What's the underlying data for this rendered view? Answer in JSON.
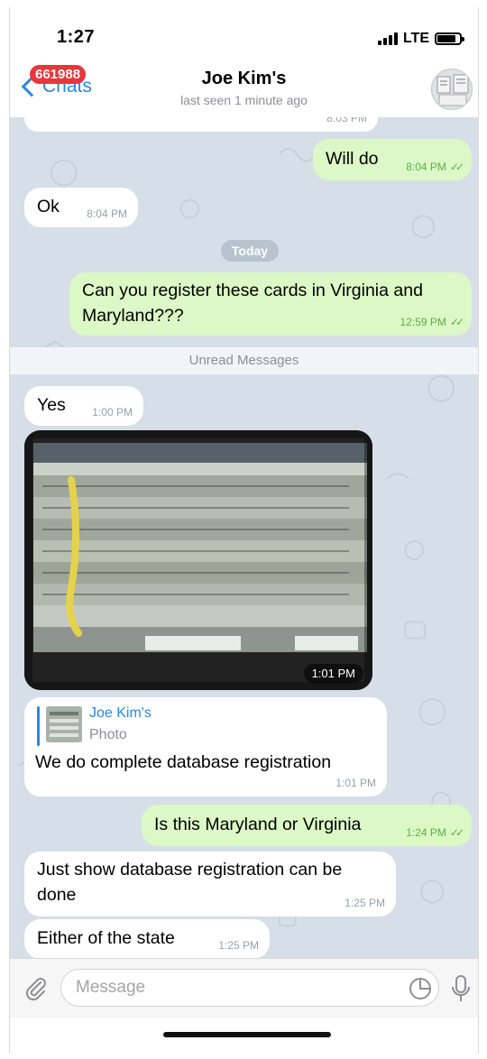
{
  "status_bar": {
    "time": "1:27",
    "network": "LTE"
  },
  "header": {
    "back_label": "Chats",
    "unread_badge": "661988",
    "title": "Joe Kim's",
    "subtitle": "last seen 1 minute ago"
  },
  "messages": {
    "partial_prev_time": "8:03 PM",
    "m1": {
      "text": "Will do",
      "time": "8:04 PM"
    },
    "m2": {
      "text": "Ok",
      "time": "8:04 PM"
    },
    "date_separator": "Today",
    "m3": {
      "text": "Can you register these cards in Virginia and Maryland???",
      "time": "12:59 PM"
    },
    "unread_separator": "Unread Messages",
    "m4": {
      "text": "Yes",
      "time": "1:00 PM"
    },
    "m5_photo": {
      "time": "1:01 PM"
    },
    "m6": {
      "reply_name": "Joe Kim's",
      "reply_type": "Photo",
      "text": "We do complete database registration",
      "time": "1:01 PM"
    },
    "m7": {
      "text": "Is this Maryland or Virginia",
      "time": "1:24 PM"
    },
    "m8": {
      "text": "Just show database registration can be done",
      "time": "1:25 PM"
    },
    "m9": {
      "text": "Either of the state",
      "time": "1:25 PM"
    }
  },
  "input": {
    "placeholder": "Message"
  },
  "colors": {
    "accent": "#2b87e3",
    "outgoing_bubble": "#dcf8c6",
    "incoming_bubble": "#ffffff",
    "chat_background": "#d6dfe8",
    "badge": "#e8363a"
  },
  "icons": [
    "back-chevron-icon",
    "signal-icon",
    "battery-icon",
    "check-icon",
    "paperclip-icon",
    "sticker-icon",
    "microphone-icon"
  ]
}
